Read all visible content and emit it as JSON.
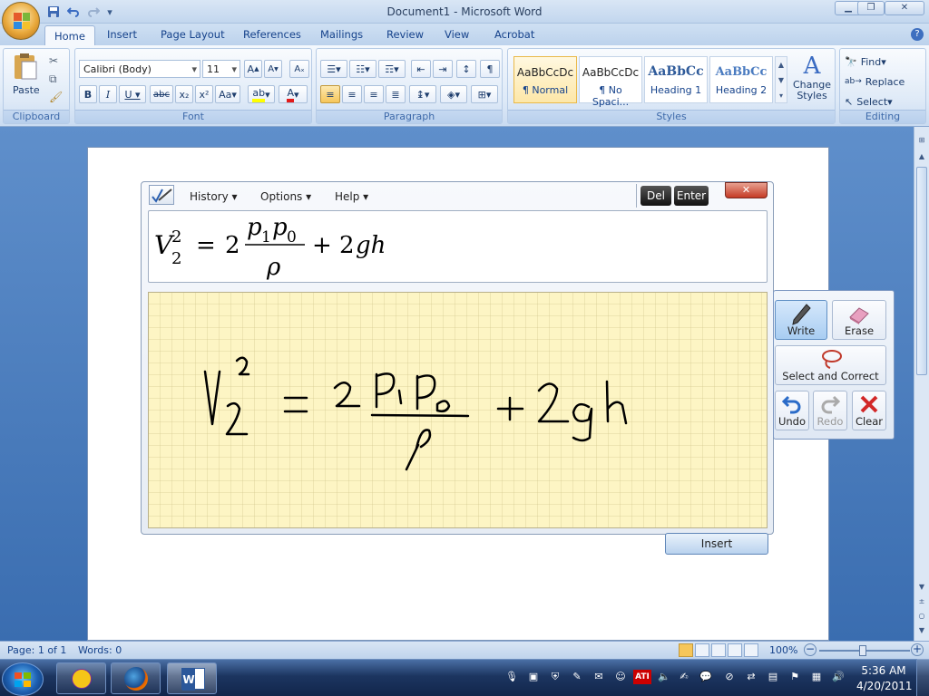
{
  "window": {
    "title": "Document1 - Microsoft Word"
  },
  "quick_access": {
    "save_icon": "save-icon",
    "undo_icon": "undo-icon",
    "redo_icon": "redo-icon"
  },
  "tabs": [
    {
      "label": "Home",
      "active": true
    },
    {
      "label": "Insert"
    },
    {
      "label": "Page Layout"
    },
    {
      "label": "References"
    },
    {
      "label": "Mailings"
    },
    {
      "label": "Review"
    },
    {
      "label": "View"
    },
    {
      "label": "Acrobat"
    }
  ],
  "ribbon": {
    "clipboard": {
      "label": "Clipboard",
      "paste": "Paste"
    },
    "font": {
      "label": "Font",
      "name": "Calibri (Body)",
      "size": "11"
    },
    "paragraph": {
      "label": "Paragraph"
    },
    "styles": {
      "label": "Styles",
      "tiles": [
        {
          "sample": "AaBbCcDc",
          "name": "¶ Normal"
        },
        {
          "sample": "AaBbCcDc",
          "name": "¶ No Spaci..."
        },
        {
          "sample": "AaBbCc",
          "name": "Heading 1"
        },
        {
          "sample": "AaBbCc",
          "name": "Heading 2"
        }
      ],
      "change_styles": "Change Styles"
    },
    "editing": {
      "label": "Editing",
      "find": "Find",
      "replace": "Replace",
      "select": "Select"
    }
  },
  "math_input": {
    "menu": {
      "history": "History",
      "options": "Options",
      "help": "Help"
    },
    "del": "Del",
    "enter": "Enter",
    "tools": {
      "write": "Write",
      "erase": "Erase",
      "select_correct": "Select and Correct",
      "undo": "Undo",
      "redo": "Redo",
      "clear": "Clear"
    },
    "insert": "Insert"
  },
  "status": {
    "page": "Page: 1 of 1",
    "words": "Words: 0",
    "zoom": "100%"
  },
  "taskbar": {
    "time": "5:36 AM",
    "date": "4/20/2011"
  },
  "colors": {
    "accent": "#15428b",
    "ink": "#000000",
    "writing_pad": "#fdf5c4",
    "clear_red": "#d22828"
  }
}
